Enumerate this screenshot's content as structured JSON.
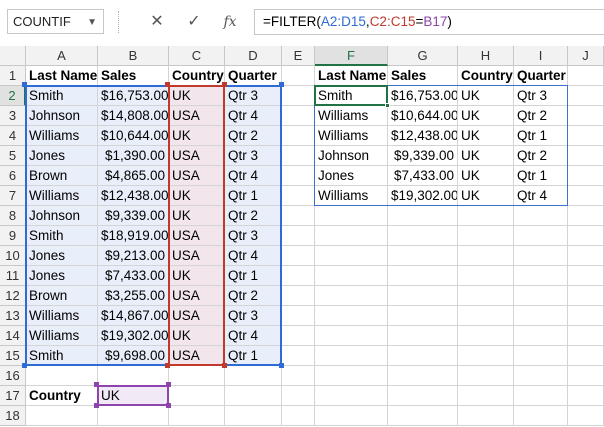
{
  "formula_bar": {
    "name_box": "COUNTIF",
    "cancel_symbol": "✕",
    "enter_symbol": "✓",
    "fx_label": "fx",
    "formula_parts": [
      {
        "text": "=FILTER(",
        "color": "#000000"
      },
      {
        "text": "A2:D15",
        "color": "#2e6bd4"
      },
      {
        "text": ",",
        "color": "#000000"
      },
      {
        "text": "C2:C15",
        "color": "#c0392b"
      },
      {
        "text": "=",
        "color": "#000000"
      },
      {
        "text": "B17",
        "color": "#8e44ad"
      },
      {
        "text": ")",
        "color": "#000000"
      }
    ]
  },
  "columns": [
    "A",
    "B",
    "C",
    "D",
    "E",
    "F",
    "G",
    "H",
    "I",
    "J"
  ],
  "rows": [
    "1",
    "2",
    "3",
    "4",
    "5",
    "6",
    "7",
    "8",
    "9",
    "10",
    "11",
    "12",
    "13",
    "14",
    "15",
    "16",
    "17",
    "18"
  ],
  "colors": {
    "accent_green": "#217346",
    "ref_blue": "#2e6bd4",
    "ref_red": "#c0392b",
    "ref_purple": "#8e44ad",
    "result_border": "#3f6fcf"
  },
  "source_table": {
    "headers": [
      "Last Name",
      "Sales",
      "Country",
      "Quarter"
    ],
    "rows": [
      [
        "Smith",
        "$16,753.00",
        "UK",
        "Qtr 3"
      ],
      [
        "Johnson",
        "$14,808.00",
        "USA",
        "Qtr 4"
      ],
      [
        "Williams",
        "$10,644.00",
        "UK",
        "Qtr 2"
      ],
      [
        "Jones",
        "$1,390.00",
        "USA",
        "Qtr 3"
      ],
      [
        "Brown",
        "$4,865.00",
        "USA",
        "Qtr 4"
      ],
      [
        "Williams",
        "$12,438.00",
        "UK",
        "Qtr 1"
      ],
      [
        "Johnson",
        "$9,339.00",
        "UK",
        "Qtr 2"
      ],
      [
        "Smith",
        "$18,919.00",
        "USA",
        "Qtr 3"
      ],
      [
        "Jones",
        "$9,213.00",
        "USA",
        "Qtr 4"
      ],
      [
        "Jones",
        "$7,433.00",
        "UK",
        "Qtr 1"
      ],
      [
        "Brown",
        "$3,255.00",
        "USA",
        "Qtr 2"
      ],
      [
        "Williams",
        "$14,867.00",
        "USA",
        "Qtr 3"
      ],
      [
        "Williams",
        "$19,302.00",
        "UK",
        "Qtr 4"
      ],
      [
        "Smith",
        "$9,698.00",
        "USA",
        "Qtr 1"
      ]
    ]
  },
  "result_table": {
    "headers": [
      "Last Name",
      "Sales",
      "Country",
      "Quarter"
    ],
    "rows": [
      [
        "Smith",
        "$16,753.00",
        "UK",
        "Qtr 3"
      ],
      [
        "Williams",
        "$10,644.00",
        "UK",
        "Qtr 2"
      ],
      [
        "Williams",
        "$12,438.00",
        "UK",
        "Qtr 1"
      ],
      [
        "Johnson",
        "$9,339.00",
        "UK",
        "Qtr 2"
      ],
      [
        "Jones",
        "$7,433.00",
        "UK",
        "Qtr 1"
      ],
      [
        "Williams",
        "$19,302.00",
        "UK",
        "Qtr 4"
      ]
    ]
  },
  "criteria": {
    "label": "Country",
    "value": "UK"
  }
}
